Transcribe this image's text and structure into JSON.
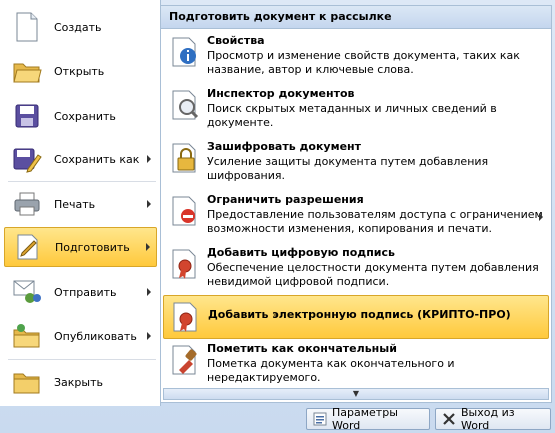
{
  "left_menu": {
    "items": [
      {
        "label": "Создать",
        "icon": "new-document-icon",
        "submenu": false
      },
      {
        "label": "Открыть",
        "icon": "open-folder-icon",
        "submenu": false
      },
      {
        "label": "Сохранить",
        "icon": "save-icon",
        "submenu": false
      },
      {
        "label": "Сохранить как",
        "icon": "save-as-icon",
        "submenu": true
      },
      {
        "label": "Печать",
        "icon": "printer-icon",
        "submenu": true
      },
      {
        "label": "Подготовить",
        "icon": "prepare-icon",
        "submenu": true,
        "selected": true
      },
      {
        "label": "Отправить",
        "icon": "send-icon",
        "submenu": true
      },
      {
        "label": "Опубликовать",
        "icon": "publish-icon",
        "submenu": true
      },
      {
        "label": "Закрыть",
        "icon": "close-folder-icon",
        "submenu": false
      }
    ]
  },
  "right_panel": {
    "header": "Подготовить документ к рассылке",
    "items": [
      {
        "title": "Свойства",
        "description": "Просмотр и изменение свойств документа, таких как название, автор и ключевые слова.",
        "icon": "properties-icon"
      },
      {
        "title": "Инспектор документов",
        "description": "Поиск скрытых метаданных и личных сведений в документе.",
        "icon": "inspector-icon"
      },
      {
        "title": "Зашифровать документ",
        "description": "Усиление защиты документа путем добавления шифрования.",
        "icon": "encrypt-lock-icon"
      },
      {
        "title": "Ограничить разрешения",
        "description": "Предоставление пользователям доступа с ограничением возможности изменения, копирования и печати.",
        "icon": "restrict-permission-icon",
        "submenu": true
      },
      {
        "title": "Добавить цифровую подпись",
        "description": "Обеспечение целостности документа путем добавления невидимой цифровой подписи.",
        "icon": "signature-ribbon-icon"
      },
      {
        "title": "Добавить электронную подпись (КРИПТО-ПРО)",
        "description": "",
        "icon": "crypto-signature-icon",
        "highlighted": true
      },
      {
        "title": "Пометить как окончательный",
        "description": "Пометка документа как окончательного и нередактируемого.",
        "icon": "mark-final-icon"
      }
    ]
  },
  "footer": {
    "options_label": "Параметры Word",
    "exit_label": "Выход из Word"
  },
  "colors": {
    "highlight": "#ffd24d",
    "panel_border": "#a9bfd6",
    "background": "#c9daef"
  }
}
